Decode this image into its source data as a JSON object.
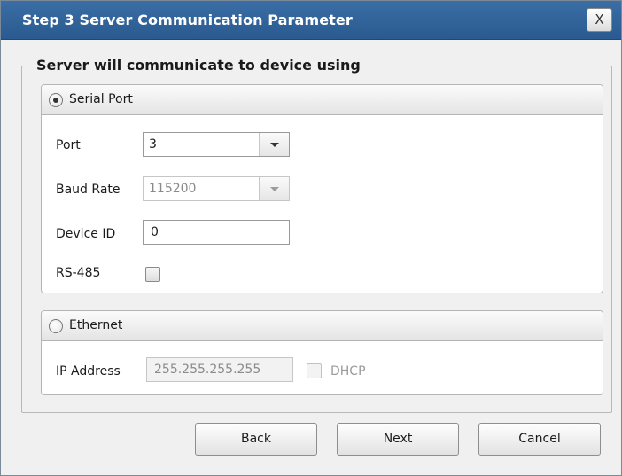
{
  "dialog": {
    "title": "Step 3 Server Communication Parameter",
    "close_label": "X",
    "legend": "Server will communicate to device using"
  },
  "serial": {
    "option_label": "Serial Port",
    "selected": true,
    "port_label": "Port",
    "port_value": "3",
    "baud_label": "Baud Rate",
    "baud_value": "115200",
    "device_id_label": "Device ID",
    "device_id_value": "0",
    "rs485_label": "RS-485",
    "rs485_checked": false
  },
  "ethernet": {
    "option_label": "Ethernet",
    "selected": false,
    "ip_label": "IP Address",
    "ip_value": "255.255.255.255",
    "dhcp_label": "DHCP",
    "dhcp_checked": false
  },
  "buttons": {
    "back": "Back",
    "next": "Next",
    "cancel": "Cancel"
  }
}
